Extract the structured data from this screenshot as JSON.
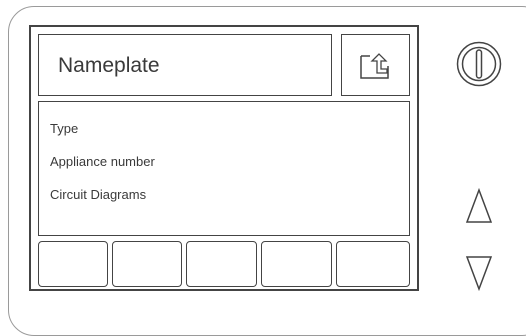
{
  "screen": {
    "title": "Nameplate",
    "menu_items": [
      {
        "label": "Type"
      },
      {
        "label": "Appliance number"
      },
      {
        "label": "Circuit Diagrams"
      }
    ]
  },
  "controls": {
    "exit_icon": "exit-arrow-icon",
    "power_icon": "power-icon",
    "up_icon": "up-triangle-icon",
    "down_icon": "down-triangle-icon"
  },
  "colors": {
    "line": "#444444",
    "text": "#3a3a3a",
    "bezel": "#9a9a9a"
  }
}
